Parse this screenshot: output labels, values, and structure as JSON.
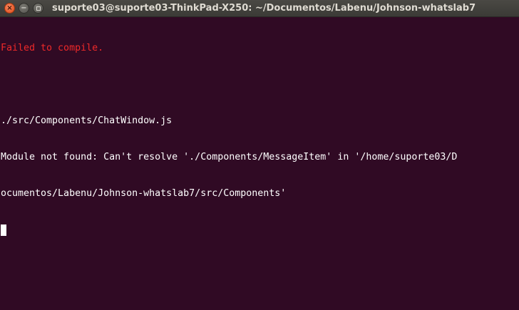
{
  "window": {
    "title": "suporte03@suporte03-ThinkPad-X250: ~/Documentos/Labenu/Johnson-whatslab7",
    "close_glyph": "×",
    "minimize_glyph": "−"
  },
  "terminal": {
    "lines": [
      "Failed to compile.",
      "",
      "./src/Components/ChatWindow.js",
      "Module not found: Can't resolve './Components/MessageItem' in '/home/suporte03/D",
      "ocumentos/Labenu/Johnson-whatslab7/src/Components'"
    ],
    "colors": {
      "background": "#300a24",
      "foreground": "#ffffff",
      "error": "#ef2929"
    }
  }
}
